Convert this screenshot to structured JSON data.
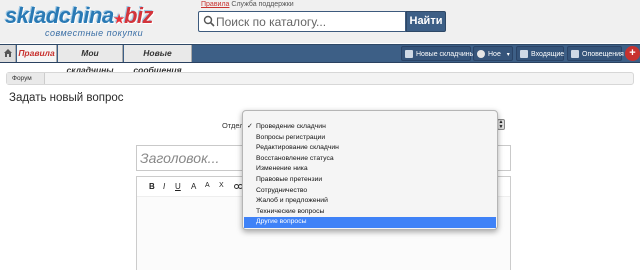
{
  "logo": {
    "main_a": "skladchina",
    "main_b": "biz",
    "subtitle": "совместные покупки"
  },
  "top_links": {
    "rules": "Правила",
    "support": "Служба поддержки"
  },
  "search": {
    "placeholder": "Поиск по каталогу...",
    "button": "Найти"
  },
  "nav": {
    "tabs": [
      {
        "label": "Правила",
        "active": true
      },
      {
        "label": "Мои складчины",
        "active": false
      },
      {
        "label": "Новые сообщения",
        "active": false
      }
    ],
    "right": {
      "new_skladchiny": "Новые складчины",
      "user": "Ное",
      "inbox": "Входящие",
      "alerts": "Оповещения",
      "plus": "+"
    }
  },
  "breadcrumb": {
    "forum": "Форум"
  },
  "page": {
    "title": "Задать новый вопрос"
  },
  "form": {
    "section_label": "Отдел:",
    "title_placeholder": "Заголовок...",
    "toolbar": [
      "B",
      "I",
      "U",
      "A",
      "A",
      "X"
    ],
    "select": {
      "options": [
        "Проведение складчин",
        "Вопросы регистрации",
        "Редактирование складчин",
        "Восстановление статуса",
        "Изменение ника",
        "Правовые претензии",
        "Сотрудничество",
        "Жалоб и предложений",
        "Технические вопросы",
        "Другие вопросы"
      ],
      "checked_index": 0,
      "highlighted_index": 9
    }
  },
  "colors": {
    "accent": "#3d5f86",
    "brand_red": "#c8322f",
    "highlight": "#3f82f7"
  }
}
